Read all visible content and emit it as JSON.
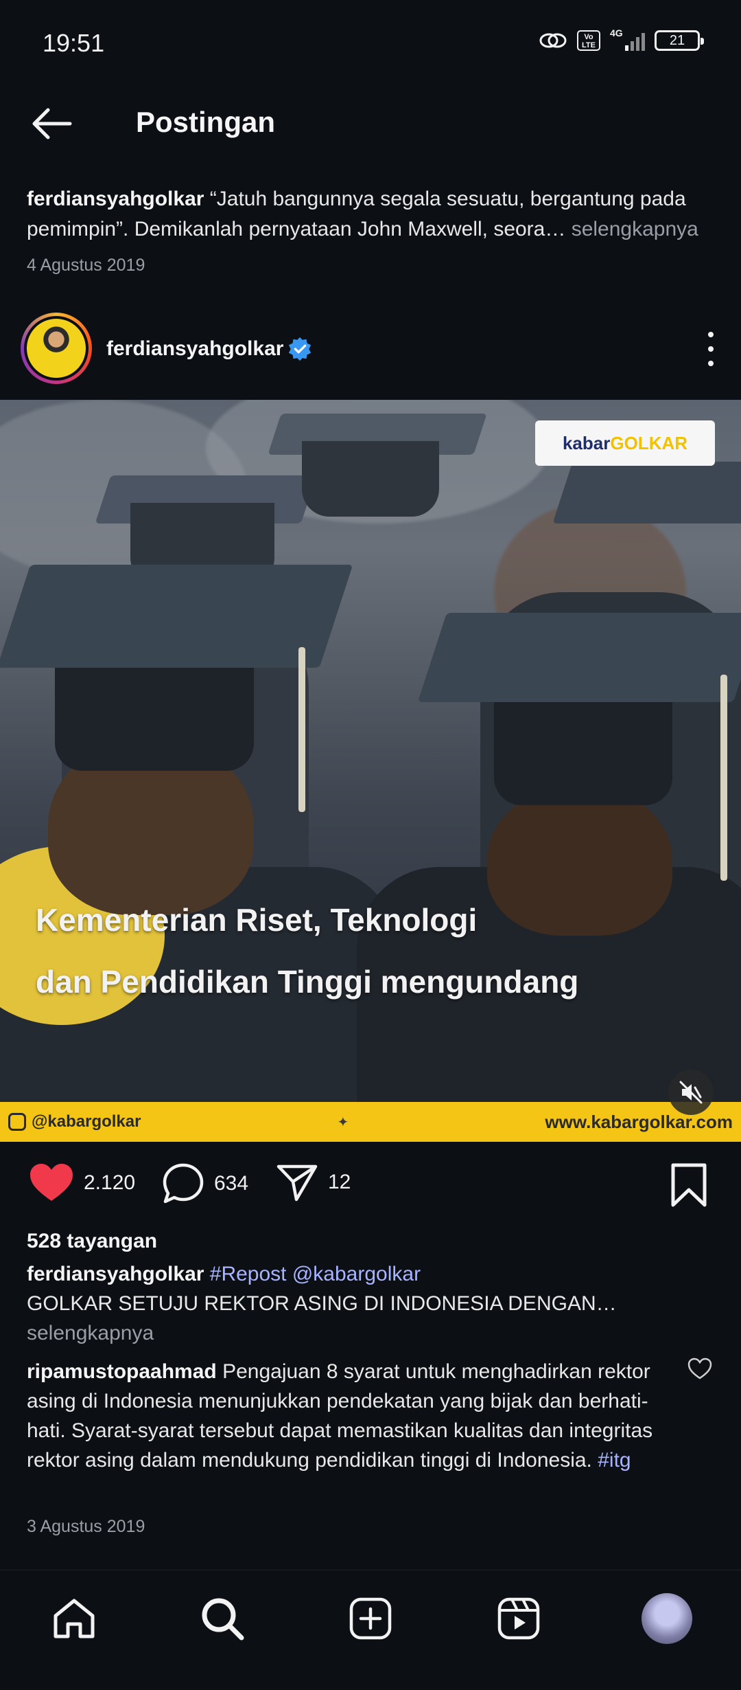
{
  "status": {
    "time": "19:51",
    "network": "4G",
    "volte": "Vo LTE",
    "battery": "21"
  },
  "header": {
    "title": "Postingan"
  },
  "previous_post": {
    "username": "ferdiansyahgolkar",
    "caption": " “Jatuh bangunnya segala sesuatu, bergantung pada pemimpin”. Demikanlah pernyataan John Maxwell, seora…",
    "more": " selengkapnya",
    "date": "4 Agustus 2019"
  },
  "post": {
    "username": "ferdiansyahgolkar",
    "media": {
      "logo_kabar": "kabar",
      "logo_golkar": "GOLKAR",
      "text_line1": "Kementerian Riset, Teknologi",
      "text_line2": "dan Pendidikan Tinggi mengundang",
      "footer_handle": "@kabargolkar",
      "footer_site": "www.kabargolkar.com"
    },
    "likes": "2.120",
    "comments": "634",
    "shares": "12",
    "views": "528 tayangan",
    "caption_user": "ferdiansyahgolkar",
    "caption_tag": " #Repost @kabargolkar",
    "caption_text": "GOLKAR SETUJU REKTOR ASING DI INDONESIA DENGAN…",
    "caption_more": "selengkapnya",
    "comment_user": "ripamustopaahmad",
    "comment_text": " Pengajuan 8 syarat untuk menghadirkan rektor asing di Indonesia menunjukkan pendekatan yang bijak dan berhati-hati. Syarat-syarat tersebut dapat memastikan kualitas dan integritas rektor asing dalam mendukung pendidikan tinggi di Indonesia. ",
    "comment_tag": "#itg",
    "date": "3 Agustus 2019"
  },
  "colors": {
    "background": "#0c0f14",
    "like": "#f0394a",
    "verified": "#3897f0",
    "link": "#a8b4ff",
    "muted": "#9a9ea6"
  },
  "icons": [
    "back-arrow-icon",
    "verified-badge-icon",
    "more-options-icon",
    "heart-icon",
    "comment-icon",
    "share-icon",
    "bookmark-icon",
    "mute-icon",
    "home-icon",
    "search-icon",
    "create-icon",
    "reels-icon",
    "profile-avatar"
  ]
}
